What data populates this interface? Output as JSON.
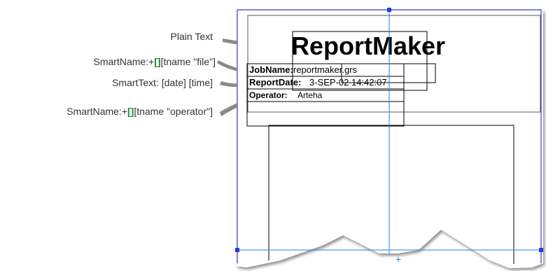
{
  "callouts": {
    "plain_text": "Plain Text",
    "smartname_file_prefix": "SmartName:+",
    "smartname_file_brackets": "[]",
    "smartname_file_suffix": "[tname \"file\"]",
    "smarttext": "SmartText: [date] [time]",
    "smartname_operator_prefix": "SmartName:+",
    "smartname_operator_brackets": "[]",
    "smartname_operator_suffix": "[tname \"operator\"]"
  },
  "report": {
    "title": "ReportMaker",
    "jobname_label": "JobName:",
    "jobname_value": "reportmaker.grs",
    "reportdate_label": "ReportDate:",
    "reportdate_value": "3-SEP-02 14:42:07",
    "operator_label": "Operator:",
    "operator_value": "Arteha"
  },
  "colors": {
    "guide_blue": "#2a7de1",
    "frame_blue": "#3a3ad0",
    "bracket_green": "#1b8a1b",
    "box_black": "#000000"
  }
}
